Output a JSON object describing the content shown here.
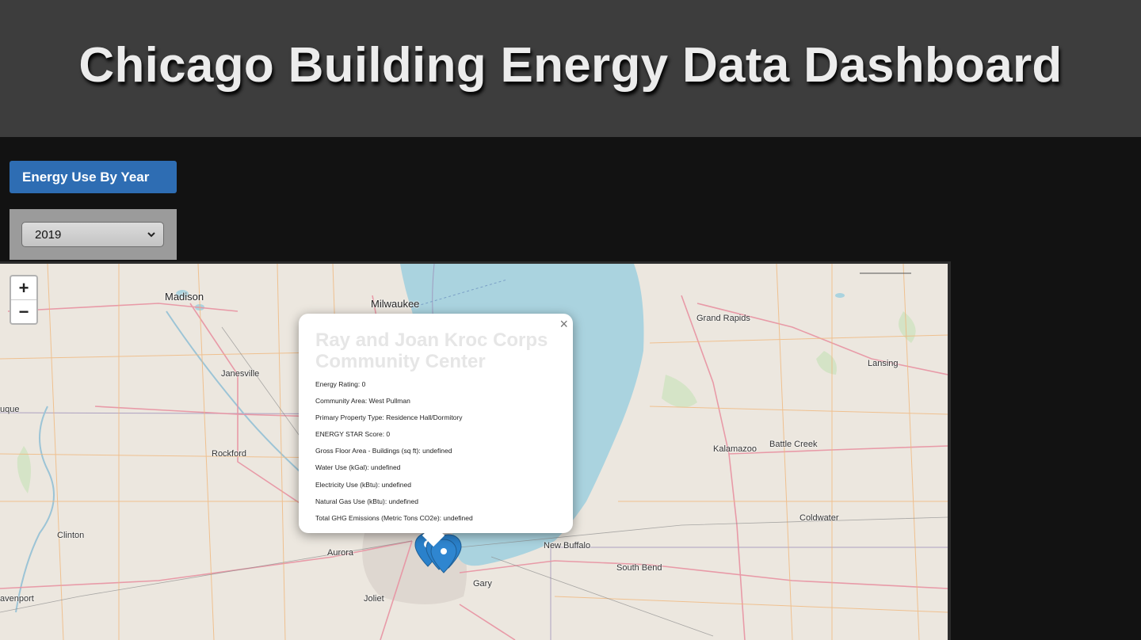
{
  "header": {
    "title": "Chicago Building Energy Data Dashboard"
  },
  "controls": {
    "energy_button_label": "Energy Use By Year",
    "year_select": {
      "value": "2019"
    }
  },
  "map": {
    "zoom_in": "+",
    "zoom_out": "−",
    "places": {
      "madison": "Madison",
      "milwaukee": "Milwaukee",
      "janesville": "Janesville",
      "dubuque": "uque",
      "rockford": "Rockford",
      "clinton": "Clinton",
      "aurora": "Aurora",
      "joliet": "Joliet",
      "davenport": "avenport",
      "gary": "Gary",
      "new_buffalo": "New Buffalo",
      "south_bend": "South Bend",
      "grand_rapids": "Grand Rapids",
      "lansing": "Lansing",
      "kalamazoo": "Kalamazoo",
      "battle_creek": "Battle Creek",
      "coldwater": "Coldwater"
    },
    "popup": {
      "close": "×",
      "title": "Ray and Joan Kroc Corps Community Center",
      "rows": [
        "Energy Rating: 0",
        "Community Area: West Pullman",
        "Primary Property Type: Residence Hall/Dormitory",
        "ENERGY STAR Score: 0",
        "Gross Floor Area - Buildings (sq ft): undefined",
        "Water Use (kGal): undefined",
        "Electricity Use (kBtu): undefined",
        "Natural Gas Use (kBtu): undefined",
        "Total GHG Emissions (Metric Tons CO2e): undefined"
      ]
    }
  },
  "colors": {
    "header_bg": "#3d3d3d",
    "page_bg": "#121212",
    "button_blue": "#2e6db3",
    "lake": "#aad3df",
    "marker": "#2a81cb"
  },
  "icons": [
    "zoom-in-icon",
    "zoom-out-icon",
    "close-icon",
    "map-marker-icon"
  ]
}
